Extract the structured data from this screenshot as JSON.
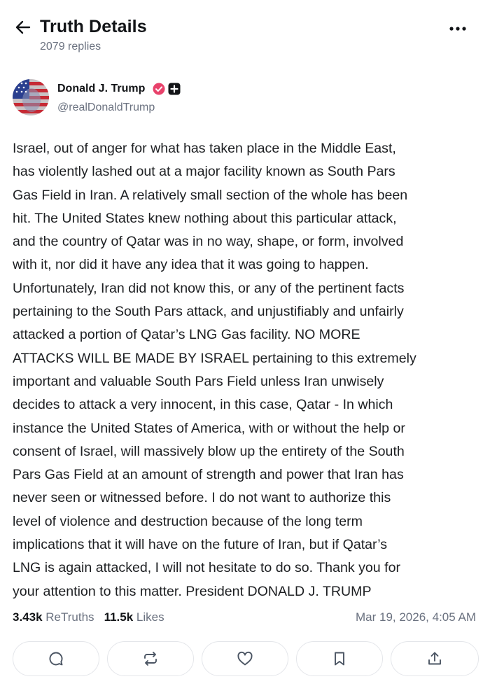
{
  "header": {
    "title": "Truth Details",
    "replies": "2079 replies"
  },
  "author": {
    "name": "Donald J. Trump",
    "handle": "@realDonaldTrump",
    "verified_color": "#e8426b"
  },
  "post": {
    "lines": [
      "Israel, out of anger for what has taken place in the Middle East,",
      "has violently lashed out at a major facility known as South Pars",
      "Gas Field in Iran. A relatively small section of the whole has been",
      "hit. The United States knew nothing about this particular attack,",
      "and the country of Qatar was in no way, shape, or form, involved",
      "with it, nor did it have any idea that it was going to happen.",
      "Unfortunately, Iran did not know this, or any of the pertinent facts",
      "pertaining to the South Pars attack, and unjustifiably and unfairly",
      "attacked a portion of Qatar’s LNG Gas facility. NO MORE",
      "ATTACKS WILL BE MADE BY ISRAEL pertaining to this extremely",
      "important and valuable South Pars Field unless Iran unwisely",
      "decides to attack a very innocent, in this case, Qatar - In which",
      "instance the United States of America, with or without the help or",
      "consent of Israel, will massively blow up the entirety of the South",
      "Pars Gas Field at an amount of strength and power that Iran has",
      "never seen or witnessed before. I do not want to authorize this",
      "level of violence and destruction because of the long term",
      "implications that it will have on the future of Iran, but if Qatar’s",
      "LNG is again attacked, I will not hesitate to do so. Thank you for",
      "your attention to this matter. President DONALD J. TRUMP"
    ]
  },
  "stats": {
    "retruths_count": "3.43k",
    "retruths_label": "ReTruths",
    "likes_count": "11.5k",
    "likes_label": "Likes",
    "timestamp": "Mar 19, 2026, 4:05 AM"
  },
  "actions": [
    {
      "icon": "reply-icon"
    },
    {
      "icon": "retruth-icon"
    },
    {
      "icon": "heart-icon"
    },
    {
      "icon": "bookmark-icon"
    },
    {
      "icon": "share-icon"
    }
  ]
}
